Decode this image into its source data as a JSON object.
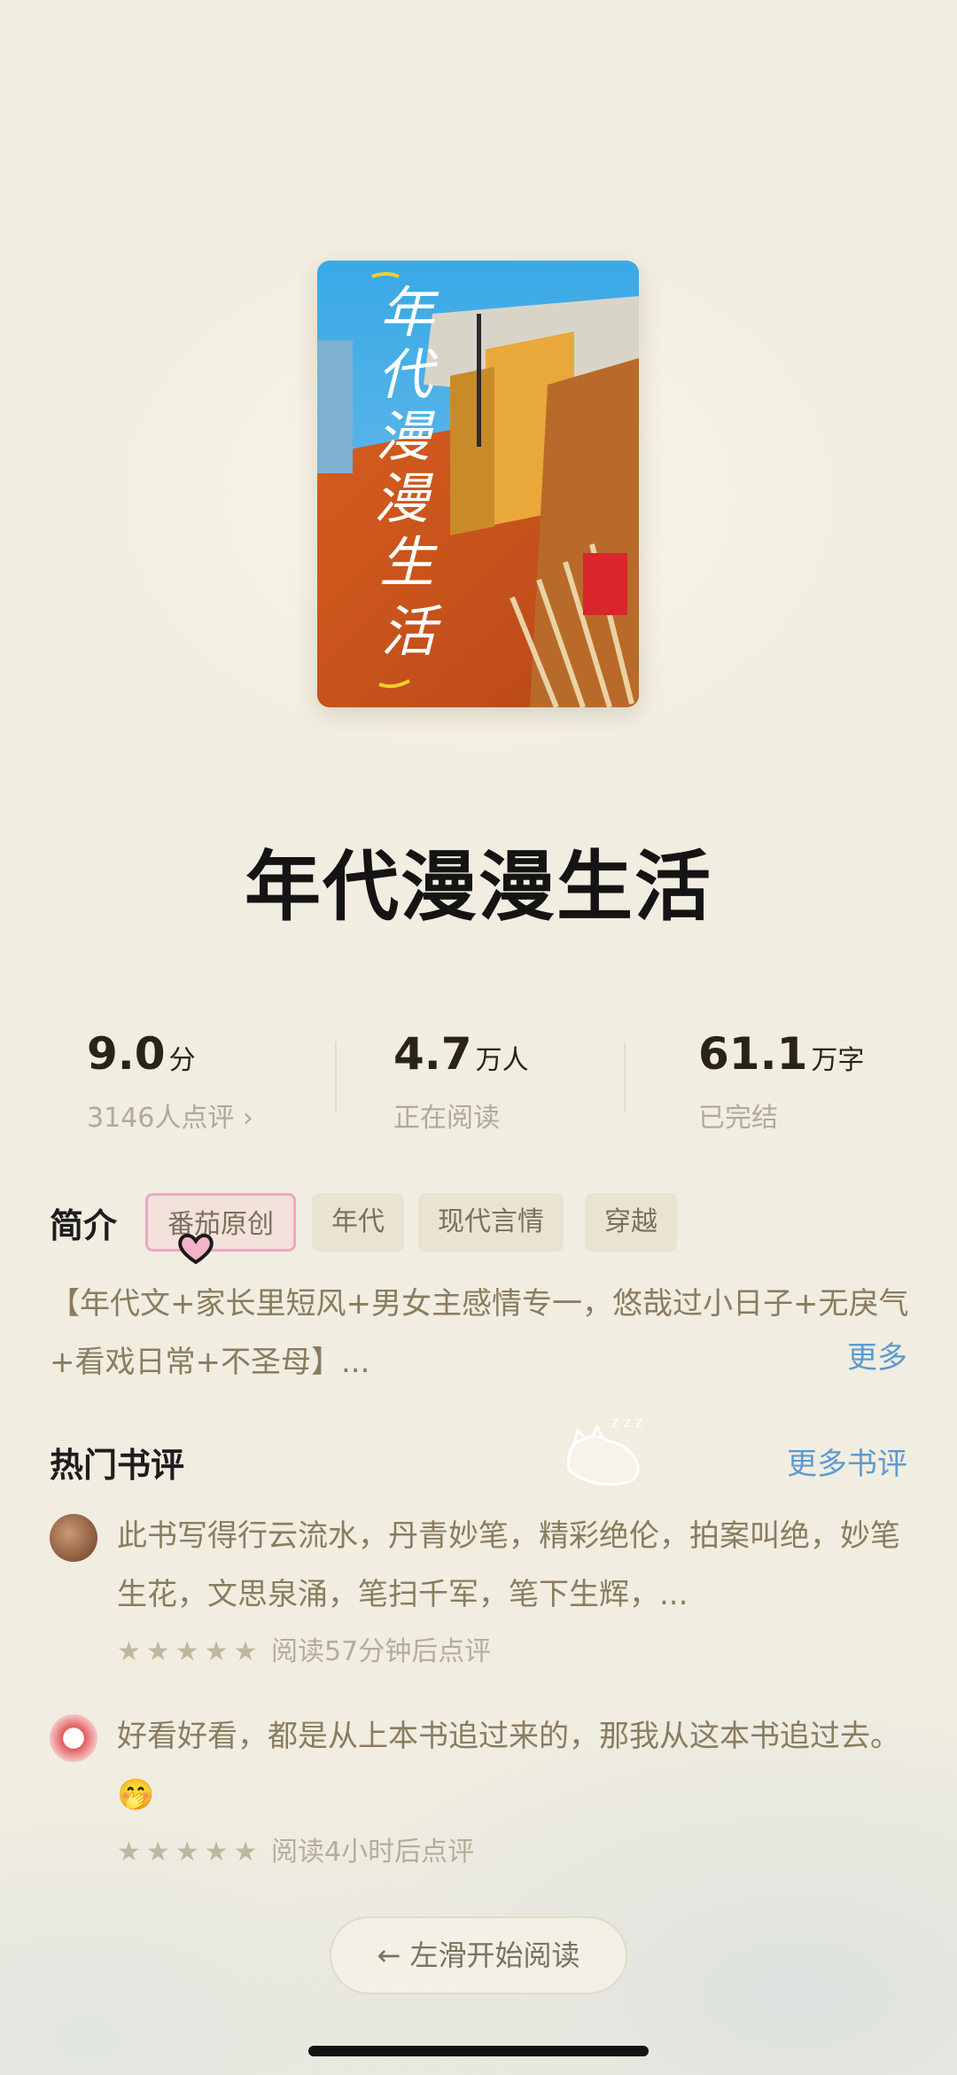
{
  "book": {
    "title": "年代漫漫生活",
    "cover_text": "年代漫漫生活"
  },
  "stats": [
    {
      "value": "9.0",
      "unit": "分",
      "sub": "3146人点评 ›"
    },
    {
      "value": "4.7",
      "unit": "万人",
      "sub": "正在阅读"
    },
    {
      "value": "61.1",
      "unit": "万字",
      "sub": "已完结"
    }
  ],
  "intro": {
    "label": "简介",
    "tags": [
      "番茄原创",
      "年代",
      "现代言情",
      "穿越"
    ],
    "text": "【年代文+家长里短风+男女主感情专一，悠哉过小日子+无戾气+看戏日常+不圣母】...",
    "more": "更多"
  },
  "reviews": {
    "label": "热门书评",
    "more": "更多书评",
    "items": [
      {
        "text": "此书写得行云流水，丹青妙笔，精彩绝伦，拍案叫绝，妙笔生花，文思泉涌，笔扫千军，笔下生辉，...",
        "stars": "★★★★★",
        "meta": "阅读57分钟后点评"
      },
      {
        "text": "好看好看，都是从上本书追过来的，那我从这本书追过去。🤭",
        "stars": "★★★★★",
        "meta": "阅读4小时后点评"
      }
    ]
  },
  "start_button": "← 左滑开始阅读",
  "colors": {
    "background": "#f1ede0",
    "link": "#5e9ad0",
    "tag_highlight": "#f0a6c0"
  }
}
